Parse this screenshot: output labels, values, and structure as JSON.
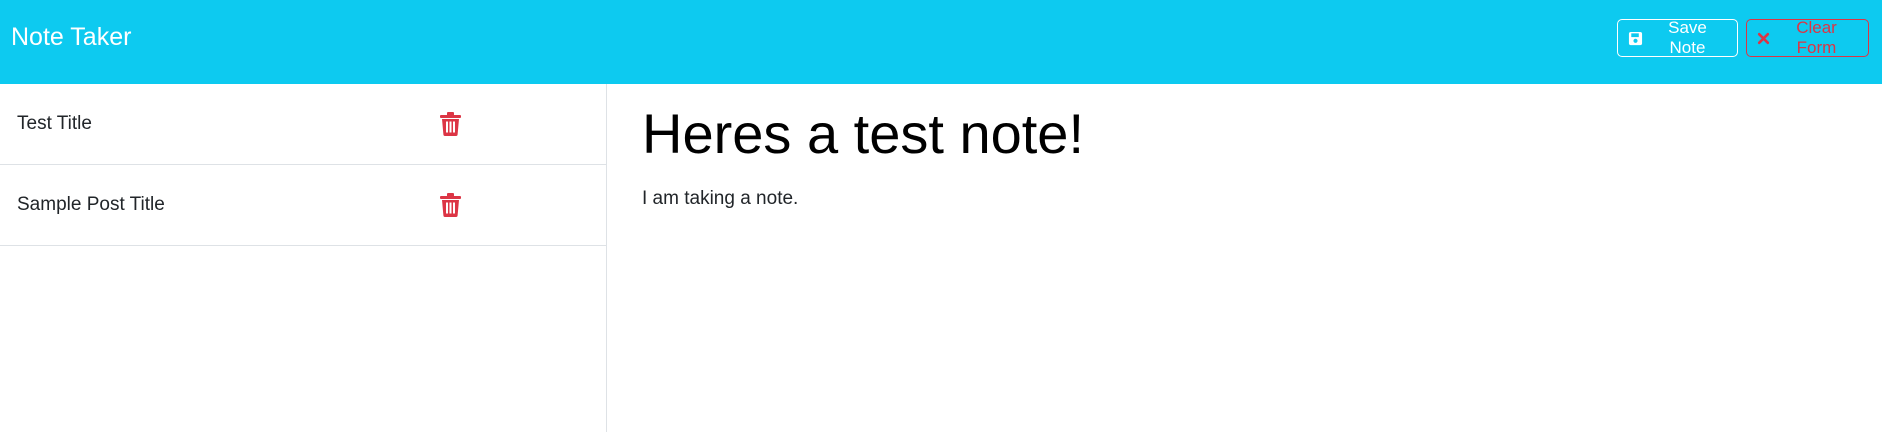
{
  "app": {
    "brand": "Note Taker"
  },
  "toolbar": {
    "save_label": "Save Note",
    "clear_label": "Clear Form"
  },
  "icons": {
    "save": "floppy-disk-icon",
    "clear": "x-mark-icon",
    "delete": "trash-icon"
  },
  "colors": {
    "navbar": "#0dcaf0",
    "danger": "#dc3545",
    "border": "#dee2e6"
  },
  "notes": [
    {
      "title": "Test Title"
    },
    {
      "title": "Sample Post Title"
    }
  ],
  "active_note": {
    "title": "Heres a test note!",
    "text": "I am taking a note."
  }
}
